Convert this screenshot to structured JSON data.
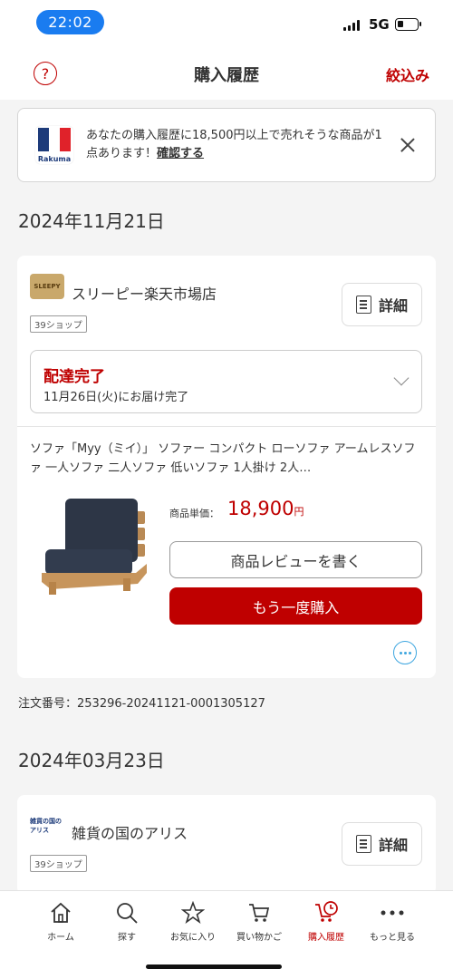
{
  "status_bar": {
    "time": "22:02",
    "network": "5G"
  },
  "header": {
    "title": "購入履歴",
    "filter_label": "絞込み"
  },
  "banner": {
    "logo_label": "Rakuma",
    "text_prefix": "あなたの購入履歴に18,500円以上で売れそうな商品が1点あります！",
    "link_label": "確認する"
  },
  "orders": [
    {
      "date": "2024年11月21日",
      "shop_name": "スリーピー楽天市場店",
      "shop_logo_text": "SLEEPY",
      "shop_badge": "39ショップ",
      "detail_label": "詳細",
      "delivery_status": "配達完了",
      "delivery_date": "11月26日(火)にお届け完了",
      "item_name": "ソファ「Myy（ミイ）」 ソファー コンパクト ローソファ アームレスソファ 一人ソファ 二人ソファ 低いソファ 1人掛け 2人…",
      "price_label": "商品単価：",
      "price": "18,900",
      "price_unit": "円",
      "review_label": "商品レビューを書く",
      "rebuy_label": "もう一度購入",
      "order_number": "注文番号：253296-20241121-0001305127"
    },
    {
      "date": "2024年03月23日",
      "shop_name": "雑貨の国のアリス",
      "shop_logo_text": "雑貨の国の アリス",
      "shop_badge": "39ショップ",
      "detail_label": "詳細"
    }
  ],
  "bottom_nav": [
    {
      "label": "ホーム",
      "icon": "home-icon"
    },
    {
      "label": "探す",
      "icon": "search-icon"
    },
    {
      "label": "お気に入り",
      "icon": "star-icon"
    },
    {
      "label": "買い物かご",
      "icon": "cart-icon"
    },
    {
      "label": "購入履歴",
      "icon": "purchase-history-icon",
      "active": true
    },
    {
      "label": "もっと見る",
      "icon": "more-icon"
    }
  ],
  "colors": {
    "accent": "#bf0000",
    "time_pill": "#1a7cf0",
    "info_blue": "#3fa7e0"
  }
}
